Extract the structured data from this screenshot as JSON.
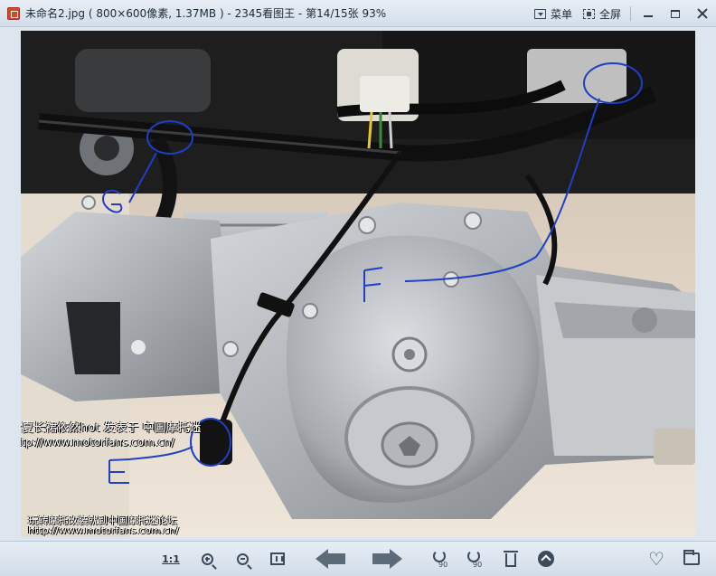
{
  "window": {
    "title": "未命名2.jpg ( 800×600像素, 1.37MB ) - 2345看图王 - 第14/15张 93%",
    "menu_label": "菜单",
    "fullscreen_label": "全屏"
  },
  "photo": {
    "annotations": {
      "g_label": "G",
      "f_label": "F",
      "e_label": "E"
    },
    "watermark_top": {
      "line1": "今夏长裙依然hot  发表于 中国摩托迷",
      "line2": "http://www.motorfans.com.cn/"
    },
    "watermark_bottom": {
      "line1": "玩转摩托改装就到中国摩托迷论坛",
      "line2": "http://www.motorfans.com.cn/"
    }
  },
  "toolbar": {
    "actual_size_label": "1:1",
    "rotate_degree_label": "90"
  },
  "colors": {
    "annotation_ink": "#1f3fc4",
    "engine_silver": "#b8bcc1",
    "titlebar": "#dbe4ee"
  },
  "icons": [
    "app-icon",
    "menu-icon",
    "fullscreen-icon",
    "minimize-icon",
    "maximize-icon",
    "close-icon",
    "zoom-in-icon",
    "zoom-out-icon",
    "fit-window-icon",
    "prev-arrow-icon",
    "next-arrow-icon",
    "rotate-left-icon",
    "rotate-right-icon",
    "delete-icon",
    "scroll-up-icon",
    "favorite-icon",
    "open-folder-icon"
  ]
}
